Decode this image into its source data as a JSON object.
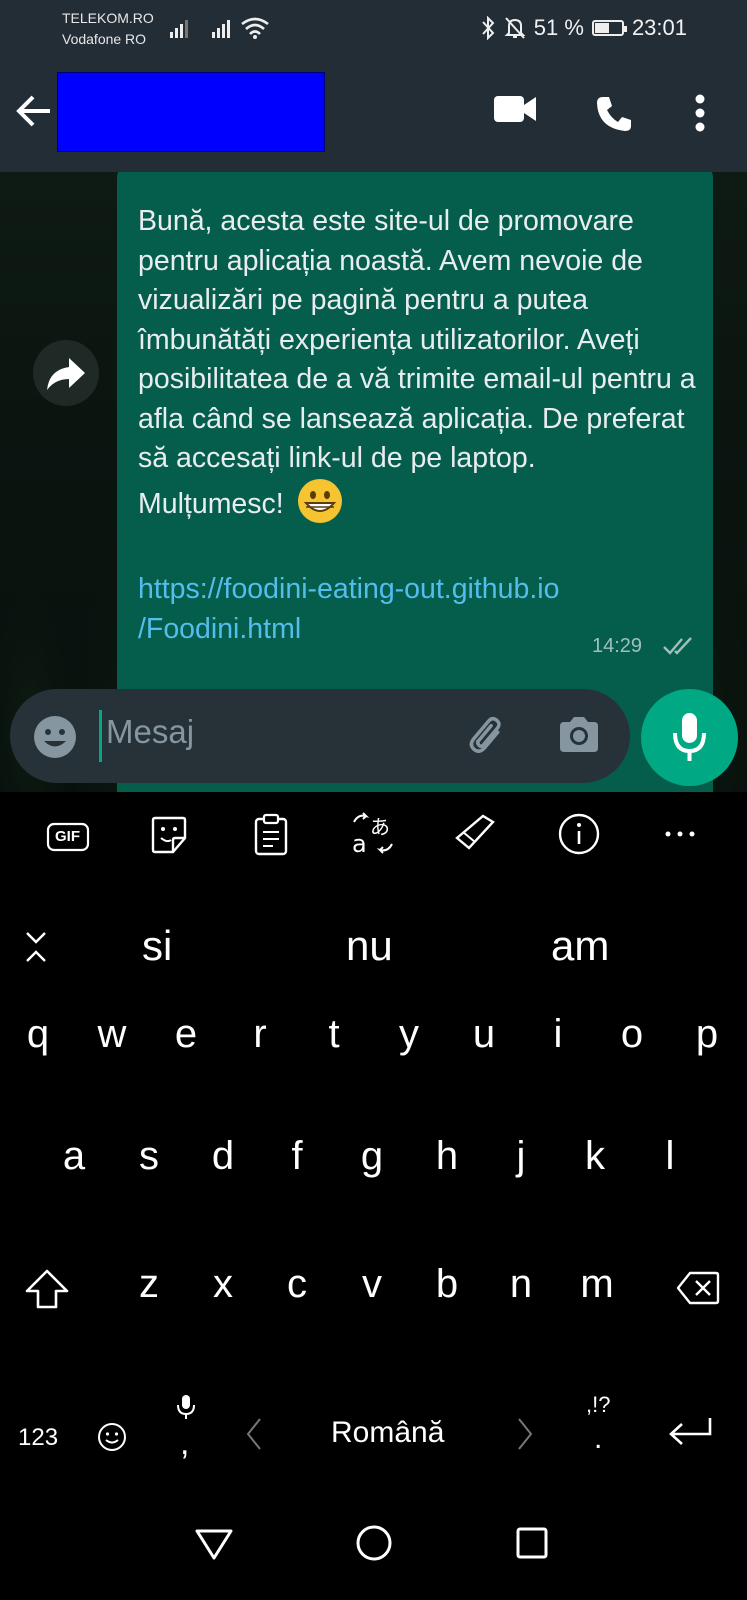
{
  "status_bar": {
    "carrier_1": "TELEKOM.RO",
    "carrier_2": "Vodafone RO",
    "battery_percent": "51 %",
    "battery_level": 0.51,
    "time": "23:01"
  },
  "header": {
    "contact_name": "",
    "icons": [
      "back-arrow-icon",
      "video-call-icon",
      "phone-call-icon",
      "more-vert-icon"
    ]
  },
  "chat": {
    "message_text": "Bună, acesta este site-ul de promovare pentru aplicația noastă. Avem nevoie de vizualizări pe pagină pentru a putea îmbunătăți experiența utilizatorilor. Aveți posibilitatea de a vă trimite email-ul pentru a afla când se lansează aplicația. De preferat să accesați link-ul de pe laptop.",
    "message_closing": "Mulțumesc!",
    "link_line_1": "https://foodini-eating-out.github.io",
    "link_line_2": "/Foodini.html",
    "time": "14:29",
    "bubble_color": "#055d4c",
    "link_color": "#53bdeb"
  },
  "composer": {
    "placeholder": "Mesaj",
    "accent_color": "#00a884"
  },
  "keyboard": {
    "toolbar_icons": [
      "gif-icon",
      "sticker-icon",
      "clipboard-icon",
      "translate-icon",
      "handwriting-icon",
      "info-icon",
      "more-icon"
    ],
    "gif_label": "GIF",
    "suggestions": [
      "si",
      "nu",
      "am"
    ],
    "row1": [
      "q",
      "w",
      "e",
      "r",
      "t",
      "y",
      "u",
      "i",
      "o",
      "p"
    ],
    "row2": [
      "a",
      "s",
      "d",
      "f",
      "g",
      "h",
      "j",
      "k",
      "l"
    ],
    "row3": [
      "z",
      "x",
      "c",
      "v",
      "b",
      "n",
      "m"
    ],
    "num_key": "123",
    "comma": ",",
    "language": "Română",
    "punct_top": ",!?",
    "period": "."
  }
}
